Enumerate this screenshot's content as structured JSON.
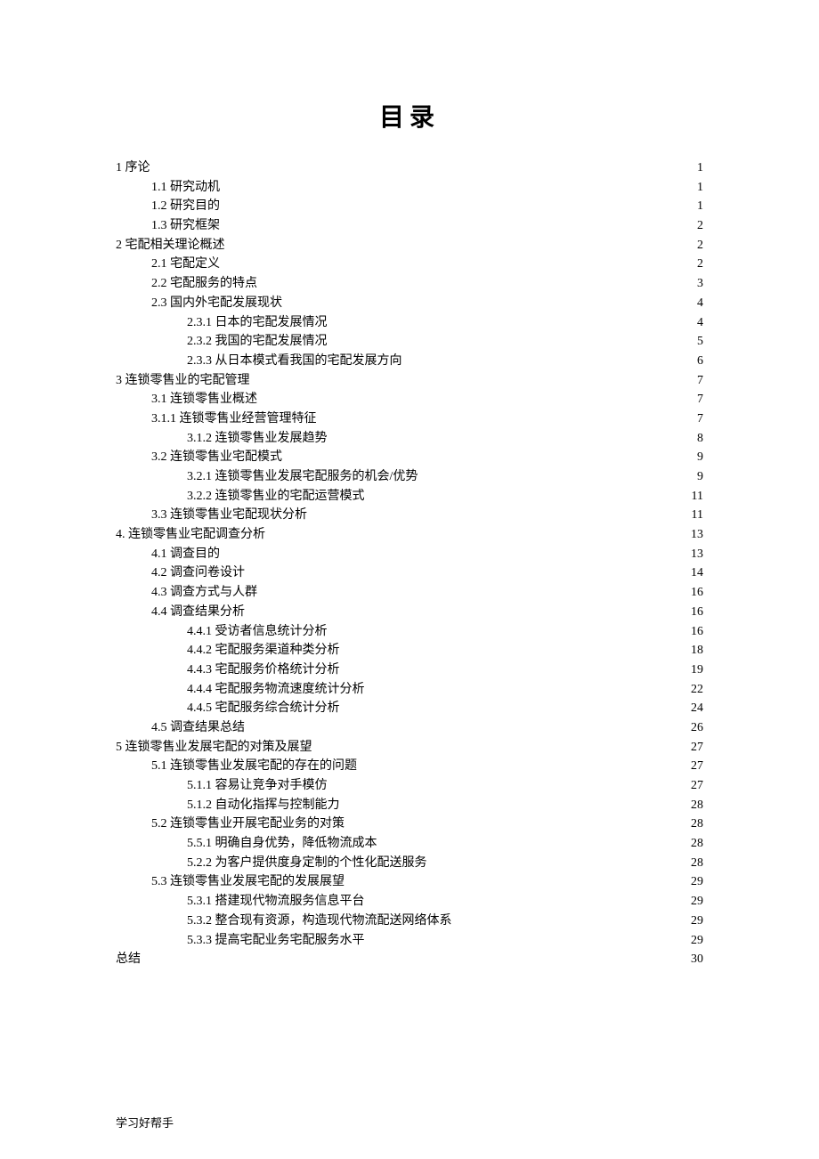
{
  "title": "目录",
  "footer": "学习好帮手",
  "items": [
    {
      "level": 0,
      "wide": true,
      "label": "1 序论",
      "page": "1"
    },
    {
      "level": 1,
      "wide": false,
      "label": "1.1 研究动机",
      "page": "1"
    },
    {
      "level": 1,
      "wide": false,
      "label": "1.2 研究目的",
      "page": "1"
    },
    {
      "level": 1,
      "wide": false,
      "label": "1.3 研究框架",
      "page": "2"
    },
    {
      "level": 0,
      "wide": true,
      "label": "2 宅配相关理论概述",
      "page": "2"
    },
    {
      "level": 1,
      "wide": false,
      "label": "2.1  宅配定义",
      "page": "2"
    },
    {
      "level": 1,
      "wide": false,
      "label": "2.2 宅配服务的特点",
      "page": "3"
    },
    {
      "level": 1,
      "wide": false,
      "label": "2.3 国内外宅配发展现状",
      "page": "4"
    },
    {
      "level": 2,
      "wide": false,
      "label": "2.3.1 日本的宅配发展情况",
      "page": "4"
    },
    {
      "level": 2,
      "wide": false,
      "label": "2.3.2 我国的宅配发展情况",
      "page": "5"
    },
    {
      "level": 2,
      "wide": false,
      "label": "2.3.3 从日本模式看我国的宅配发展方向",
      "page": "6"
    },
    {
      "level": 0,
      "wide": true,
      "label": "3 连锁零售业的宅配管理",
      "page": "7"
    },
    {
      "level": 1,
      "wide": false,
      "label": "3.1 连锁零售业概述",
      "page": "7"
    },
    {
      "level": 1,
      "wide": false,
      "label": "3.1.1 连锁零售业经营管理特征",
      "page": "7"
    },
    {
      "level": 2,
      "wide": false,
      "label": "3.1.2 连锁零售业发展趋势",
      "page": "8"
    },
    {
      "level": 1,
      "wide": false,
      "label": "3.2 连锁零售业宅配模式",
      "page": "9"
    },
    {
      "level": 2,
      "wide": false,
      "label": "3.2.1 连锁零售业发展宅配服务的机会/优势 ",
      "page": "9"
    },
    {
      "level": 2,
      "wide": false,
      "label": "3.2.2 连锁零售业的宅配运营模式",
      "page": "11"
    },
    {
      "level": 1,
      "wide": false,
      "label": "3.3 连锁零售业宅配现状分析",
      "page": "11"
    },
    {
      "level": 0,
      "wide": true,
      "label": "4. 连锁零售业宅配调查分析",
      "page": "13"
    },
    {
      "level": 1,
      "wide": false,
      "label": "4.1 调查目的",
      "page": "13"
    },
    {
      "level": 1,
      "wide": false,
      "label": "4.2 调查问卷设计",
      "page": "14"
    },
    {
      "level": 1,
      "wide": false,
      "label": "4.3 调查方式与人群",
      "page": "16"
    },
    {
      "level": 1,
      "wide": false,
      "label": "4.4 调查结果分析",
      "page": "16"
    },
    {
      "level": 2,
      "wide": false,
      "label": "4.4.1 受访者信息统计分析",
      "page": "16"
    },
    {
      "level": 2,
      "wide": false,
      "label": "4.4.2 宅配服务渠道种类分析",
      "page": "18"
    },
    {
      "level": 2,
      "wide": false,
      "label": "4.4.3 宅配服务价格统计分析",
      "page": "19"
    },
    {
      "level": 2,
      "wide": false,
      "label": "4.4.4 宅配服务物流速度统计分析",
      "page": "22"
    },
    {
      "level": 2,
      "wide": false,
      "label": "4.4.5 宅配服务综合统计分析",
      "page": "24"
    },
    {
      "level": 1,
      "wide": false,
      "label": "4.5 调查结果总结",
      "page": "26"
    },
    {
      "level": 0,
      "wide": true,
      "label": "5 连锁零售业发展宅配的对策及展望",
      "page": "27"
    },
    {
      "level": 1,
      "wide": false,
      "label": "5.1 连锁零售业发展宅配的存在的问题",
      "page": "27"
    },
    {
      "level": 2,
      "wide": false,
      "label": "5.1.1 容易让竞争对手模仿",
      "page": "27"
    },
    {
      "level": 2,
      "wide": false,
      "label": "5.1.2 自动化指挥与控制能力",
      "page": "28"
    },
    {
      "level": 1,
      "wide": false,
      "label": "5.2 连锁零售业开展宅配业务的对策",
      "page": "28"
    },
    {
      "level": 2,
      "wide": false,
      "label": "5.5.1 明确自身优势，降低物流成本",
      "page": "28"
    },
    {
      "level": 2,
      "wide": false,
      "label": "5.2.2 为客户提供度身定制的个性化配送服务",
      "page": "28"
    },
    {
      "level": 1,
      "wide": false,
      "label": "5.3 连锁零售业发展宅配的发展展望",
      "page": "29"
    },
    {
      "level": 2,
      "wide": false,
      "label": "5.3.1 搭建现代物流服务信息平台",
      "page": "29"
    },
    {
      "level": 2,
      "wide": false,
      "label": "5.3.2 整合现有资源，构造现代物流配送网络体系",
      "page": "29"
    },
    {
      "level": 2,
      "wide": false,
      "label": "5.3.3 提高宅配业务宅配服务水平",
      "page": "29"
    },
    {
      "level": 0,
      "wide": true,
      "label": "总结",
      "page": "30"
    }
  ]
}
